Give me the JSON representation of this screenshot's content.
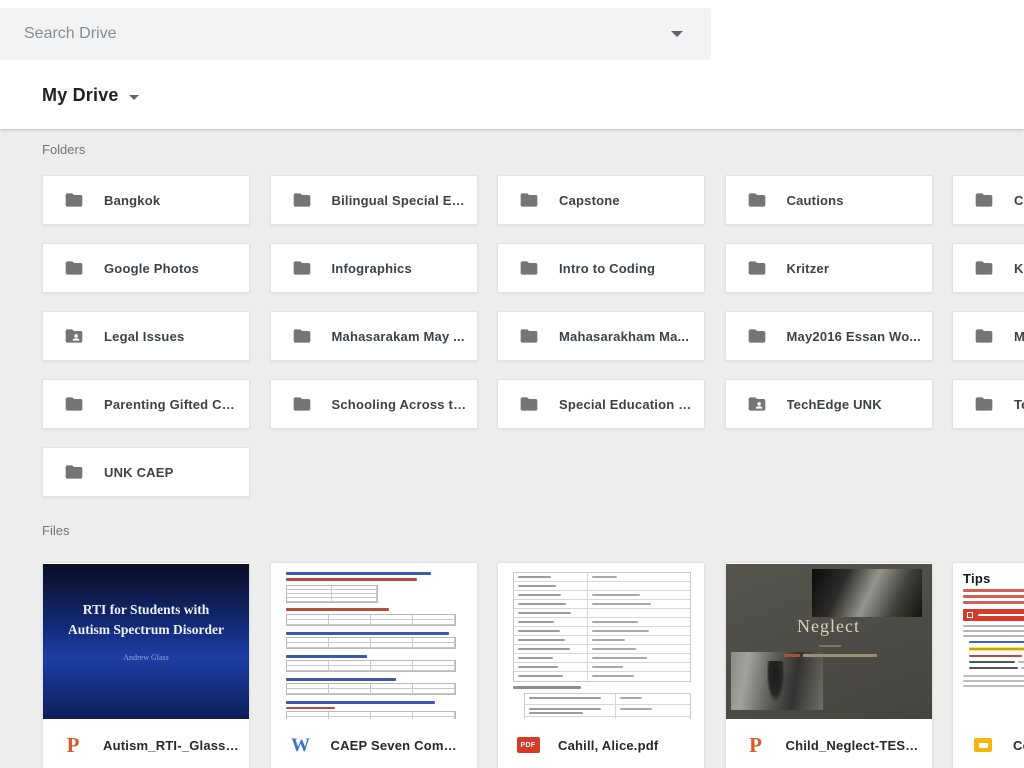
{
  "search": {
    "placeholder": "Search Drive"
  },
  "header": {
    "title": "My Drive"
  },
  "labels": {
    "folders": "Folders",
    "files": "Files"
  },
  "colors": {
    "content_bg": "#ededee",
    "folder_icon": "#757575",
    "powerpoint_accent": "#dd5a2c",
    "word_accent": "#3b72cc",
    "pdf_accent": "#d63a28",
    "slides_accent": "#f3b50f"
  },
  "folders": [
    {
      "label": "Bangkok",
      "shared": false
    },
    {
      "label": "Bilingual Special Ed...",
      "shared": false
    },
    {
      "label": "Capstone",
      "shared": false
    },
    {
      "label": "Cautions",
      "shared": false
    },
    {
      "label": "Cr",
      "shared": false
    },
    {
      "label": "Google Photos",
      "shared": false
    },
    {
      "label": "Infographics",
      "shared": false
    },
    {
      "label": "Intro to Coding",
      "shared": false
    },
    {
      "label": "Kritzer",
      "shared": false
    },
    {
      "label": "Kr",
      "shared": false
    },
    {
      "label": "Legal Issues",
      "shared": true
    },
    {
      "label": "Mahasarakam May ...",
      "shared": false
    },
    {
      "label": "Mahasarakham Ma...",
      "shared": false
    },
    {
      "label": "May2016 Essan Wo...",
      "shared": false
    },
    {
      "label": "M",
      "shared": false
    },
    {
      "label": "Parenting Gifted Chi...",
      "shared": false
    },
    {
      "label": "Schooling Across th...",
      "shared": false
    },
    {
      "label": "Special Education P...",
      "shared": false
    },
    {
      "label": "TechEdge UNK",
      "shared": true
    },
    {
      "label": "Te",
      "shared": false
    },
    {
      "label": "UNK CAEP",
      "shared": false
    }
  ],
  "files": [
    {
      "name": "Autism_RTI-_Glass....",
      "type": "powerpoint"
    },
    {
      "name": "CAEP Seven Comm...",
      "type": "word"
    },
    {
      "name": "Cahill, Alice.pdf",
      "type": "pdf"
    },
    {
      "name": "Child_Neglect-TESE...",
      "type": "powerpoint"
    },
    {
      "name": "Co",
      "type": "slides"
    }
  ],
  "thumbnails": {
    "autism": {
      "title": "RTI for Students with Autism Spectrum Disorder",
      "author": "Andrew Glass"
    },
    "neglect": {
      "title": "Neglect"
    },
    "tips": {
      "title": "Tips"
    },
    "pdf_badge": "PDF",
    "ppt_letter": "P",
    "word_letter": "W"
  }
}
